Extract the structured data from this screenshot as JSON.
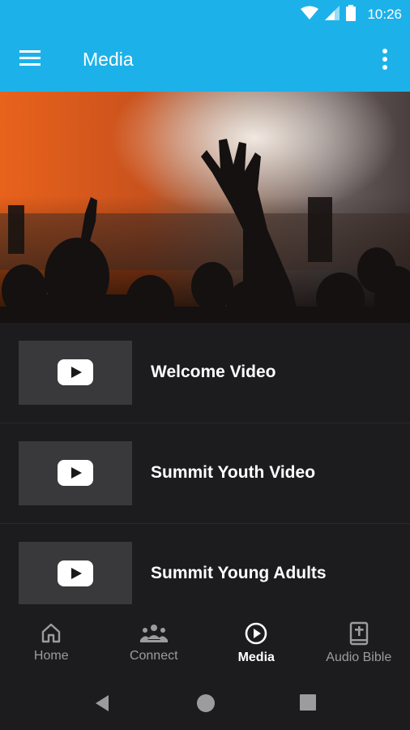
{
  "status_bar": {
    "time": "10:26",
    "icons": [
      "wifi-icon",
      "cell-signal-icon",
      "battery-icon"
    ],
    "color": "#1db1ea"
  },
  "app_bar": {
    "title": "Media",
    "menu_icon": "hamburger-menu-icon",
    "more_icon": "more-vert-icon",
    "background": "#1db1ea"
  },
  "hero": {
    "description_icon": "concert-crowd-banner"
  },
  "media_list": {
    "items": [
      {
        "label": "Welcome Video",
        "icon": "youtube-play-icon"
      },
      {
        "label": "Summit Youth Video",
        "icon": "youtube-play-icon"
      },
      {
        "label": "Summit Young Adults",
        "icon": "youtube-play-icon"
      }
    ]
  },
  "bottom_nav": {
    "items": [
      {
        "label": "Home",
        "icon": "home-icon",
        "active": false
      },
      {
        "label": "Connect",
        "icon": "group-icon",
        "active": false
      },
      {
        "label": "Media",
        "icon": "play-circle-icon",
        "active": true
      },
      {
        "label": "Audio Bible",
        "icon": "bible-icon",
        "active": false
      }
    ]
  },
  "system_nav": {
    "buttons": [
      "back-icon",
      "home-circle-icon",
      "recents-icon"
    ]
  }
}
